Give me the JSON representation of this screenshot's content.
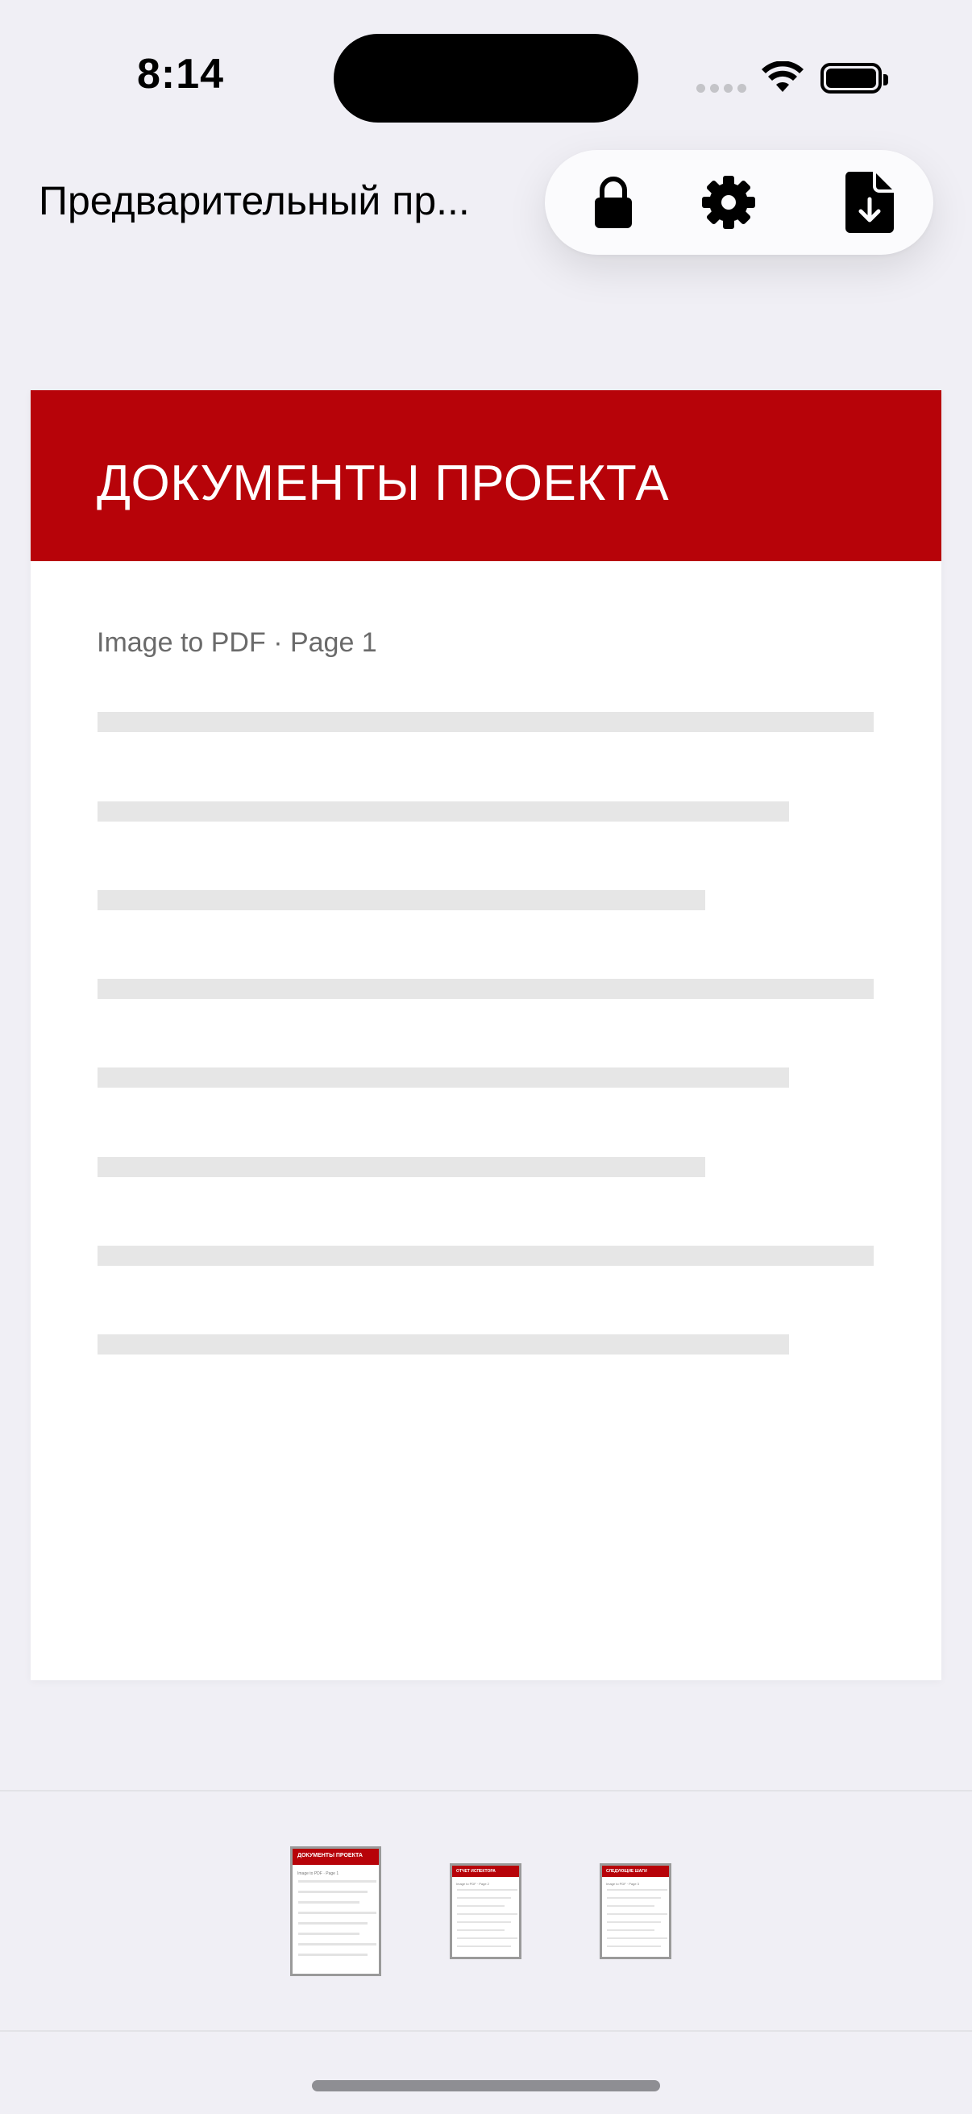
{
  "status_bar": {
    "time": "8:14"
  },
  "nav": {
    "title": "Предварительный пр...",
    "toolbar": {
      "icons": [
        "lock-icon",
        "gear-icon",
        "document-download-icon"
      ]
    }
  },
  "page_preview": {
    "header_title": "ДОКУМЕНТЫ ПРОЕКТА",
    "subtitle": "Image to PDF · Page 1",
    "header_color": "#b70309",
    "placeholder_line_count": 8
  },
  "thumbnails": [
    {
      "title": "ДОКУМЕНТЫ ПРОЕКТА",
      "subtitle": "Image to PDF · Page 1",
      "selected": true
    },
    {
      "title": "ОТЧЕТ ИСПЕКТОРА",
      "subtitle": "Image to PDF · Page 2",
      "selected": false
    },
    {
      "title": "СЛЕДУЮЩИЕ ШАГИ",
      "subtitle": "Image to PDF · Page 3",
      "selected": false
    }
  ]
}
